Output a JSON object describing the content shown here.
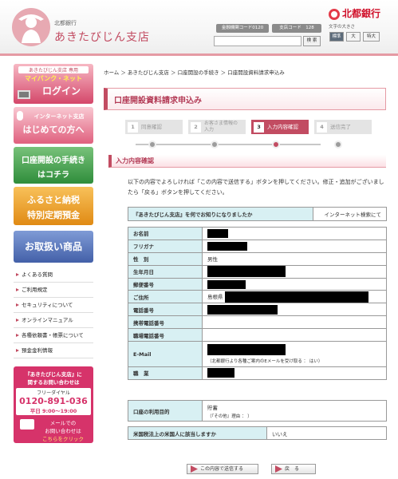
{
  "header": {
    "bank_small": "北都銀行",
    "branch_name": "あきたびじん支店",
    "bank_brand": "北都銀行",
    "institution_code": "金融機関コード0120",
    "branch_code": "支店コード　128",
    "search_button": "検 索",
    "search_placeholder": "",
    "fontsize_label": "文字の大きさ",
    "fontsize_options": [
      "標準",
      "大",
      "特大"
    ]
  },
  "sidebar": {
    "mybank": {
      "top_label": "あきたびじん支店 専用",
      "sub": "マイバンク・ネット",
      "login": "ログイン"
    },
    "first_time": {
      "top": "インターネット支店",
      "main": "はじめての方へ"
    },
    "account_open": {
      "line1": "口座開設の手続き",
      "line2": "はコチラ"
    },
    "hometown": {
      "line1": "ふるさと納税",
      "line2": "特別定期預金"
    },
    "products": "お取扱い商品",
    "menu": [
      "よくある質問",
      "ご利用規定",
      "セキュリティについて",
      "オンラインマニュアル",
      "各種依頼書・帳票について",
      "預金金利情報"
    ],
    "contact": {
      "title1": "『あきたびじん支店』に",
      "title2": "関するお問い合わせは",
      "free_dial": "フリーダイヤル",
      "phone": "0120-891-036",
      "hours": "平日 9:00〜19:00",
      "mail1": "メールでの",
      "mail2": "お問い合わせは",
      "mail3": "こちらをクリック"
    }
  },
  "breadcrumb": "ホーム ＞ あきたびじん支店 ＞ 口座開設の手続き ＞ 口座開設資料請求申込み",
  "page_title": "口座開設資料請求申込み",
  "steps": [
    {
      "num": "1",
      "label": "同意確認"
    },
    {
      "num": "2",
      "label": "お客さま情報の入力"
    },
    {
      "num": "3",
      "label": "入力内容確認"
    },
    {
      "num": "4",
      "label": "送信完了"
    }
  ],
  "section_title": "入力内容確認",
  "intro": "以下の内容でよろしければ「この内容で送信する」ボタンを押してください。修正・追加がございましたら「戻る」ボタンを押してください。",
  "how_known": {
    "question": "『あきたびじん支店』を何でお知りになりましたか",
    "answer": "インターネット検索にて"
  },
  "details": [
    {
      "label": "お名前",
      "value": ""
    },
    {
      "label": "フリガナ",
      "value": ""
    },
    {
      "label": "性　別",
      "value": "男性"
    },
    {
      "label": "生年月日",
      "value": ""
    },
    {
      "label": "郵便番号",
      "value": ""
    },
    {
      "label": "ご住所",
      "value": "島根県"
    },
    {
      "label": "電話番号",
      "value": ""
    },
    {
      "label": "携帯電話番号",
      "value": ""
    },
    {
      "label": "職場電話番号",
      "value": ""
    },
    {
      "label": "E-Mail",
      "value": ""
    },
    {
      "label": "職　業",
      "value": ""
    }
  ],
  "email_note": "（北都銀行より各種ご案内のEメールを受け取る ： はい）",
  "purpose": {
    "label": "口座の利用目的",
    "value": "貯蓄",
    "other": "（『その他』理由 ： ）"
  },
  "us_tax": {
    "label": "米国税法上の米国人に該当しますか",
    "value": "いいえ"
  },
  "buttons": {
    "submit": "この内容で送信する",
    "back": "戻　る"
  }
}
